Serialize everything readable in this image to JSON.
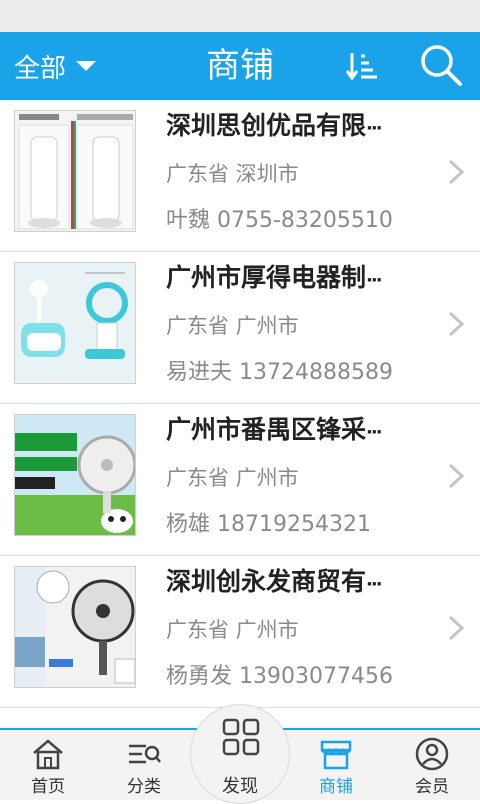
{
  "header": {
    "filter_label": "全部",
    "title": "商铺",
    "accent": "#1aa3e8"
  },
  "shops": [
    {
      "name": "深圳思创优品有限",
      "ellipsis": "···",
      "location": "广东省 深圳市",
      "contact": "叶魏 0755-83205510",
      "image": "tower-fan-product-photo"
    },
    {
      "name": "广州市厚得电器制",
      "ellipsis": "···",
      "location": "广东省 广州市",
      "contact": "易进夫 13724888589",
      "image": "bladeless-fan-humidifier-photo"
    },
    {
      "name": "广州市番禺区锋采",
      "ellipsis": "···",
      "location": "广东省 广州市",
      "contact": "杨雄 18719254321",
      "image": "panda-desk-fan-banner"
    },
    {
      "name": "深圳创永发商贸有",
      "ellipsis": "···",
      "location": "广东省 广州市",
      "contact": "杨勇发 13903077456",
      "image": "wall-fan-product-photo"
    }
  ],
  "tabs": [
    {
      "label": "首页",
      "icon": "home-icon"
    },
    {
      "label": "分类",
      "icon": "category-search-icon"
    },
    {
      "label": "发现",
      "icon": "grid-icon"
    },
    {
      "label": "商铺",
      "icon": "store-icon",
      "active": true
    },
    {
      "label": "会员",
      "icon": "user-icon"
    }
  ],
  "colors": {
    "active_tab": "#1aa3e8",
    "muted_text": "#8a8a8a"
  }
}
